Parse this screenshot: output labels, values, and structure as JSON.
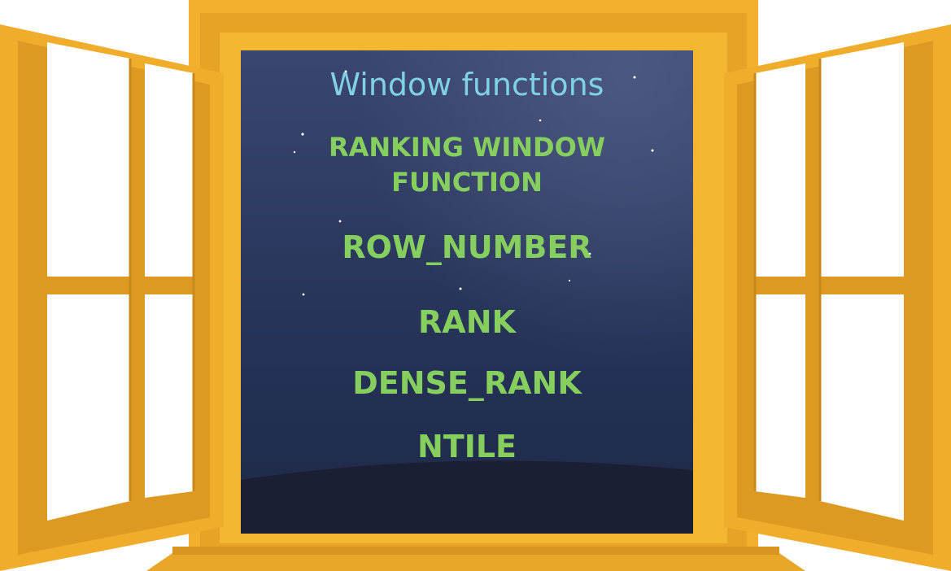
{
  "title": "Window functions",
  "subtitle_lines": [
    "RANKING WINDOW",
    "FUNCTION"
  ],
  "items": [
    "ROW_NUMBER",
    "RANK",
    "DENSE_RANK",
    "NTILE"
  ],
  "colors": {
    "title": "#7fd1e6",
    "text_green": "#86cf5e",
    "sky_top": "#2f3f6a",
    "sky_bottom": "#1b2440",
    "frame": "#f0b233",
    "frame_dark": "#d49621",
    "glass": "#ffffff"
  }
}
